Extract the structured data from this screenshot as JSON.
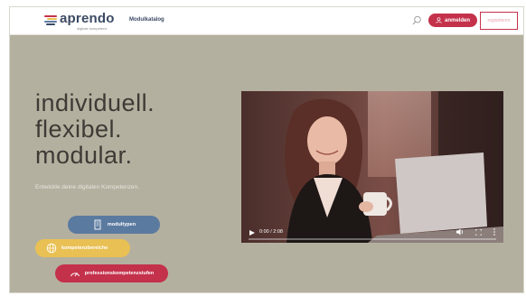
{
  "header": {
    "logo_word": "aprendo",
    "logo_tagline": "digitale kompetenz",
    "nav_link": "Modulkatalog",
    "login_label": "anmelden",
    "register_label": "registrieren"
  },
  "hero": {
    "title_lines": [
      "individuell.",
      "flexibel.",
      "modular."
    ],
    "subtitle": "Entwickle deine digitalen Kompetenzen."
  },
  "buttons": {
    "module_types": "modultypen",
    "competence_areas": "kompetenzbereiche",
    "competence_levels": "professionskompetenzstufen"
  },
  "video": {
    "time": "0:00 / 2:08",
    "progress": 0
  },
  "colors": {
    "accent_red": "#c4314b",
    "pill_blue": "#5b7aa0",
    "pill_yellow": "#e9c054",
    "navy": "#3b4a63",
    "background": "#b4b09f"
  }
}
